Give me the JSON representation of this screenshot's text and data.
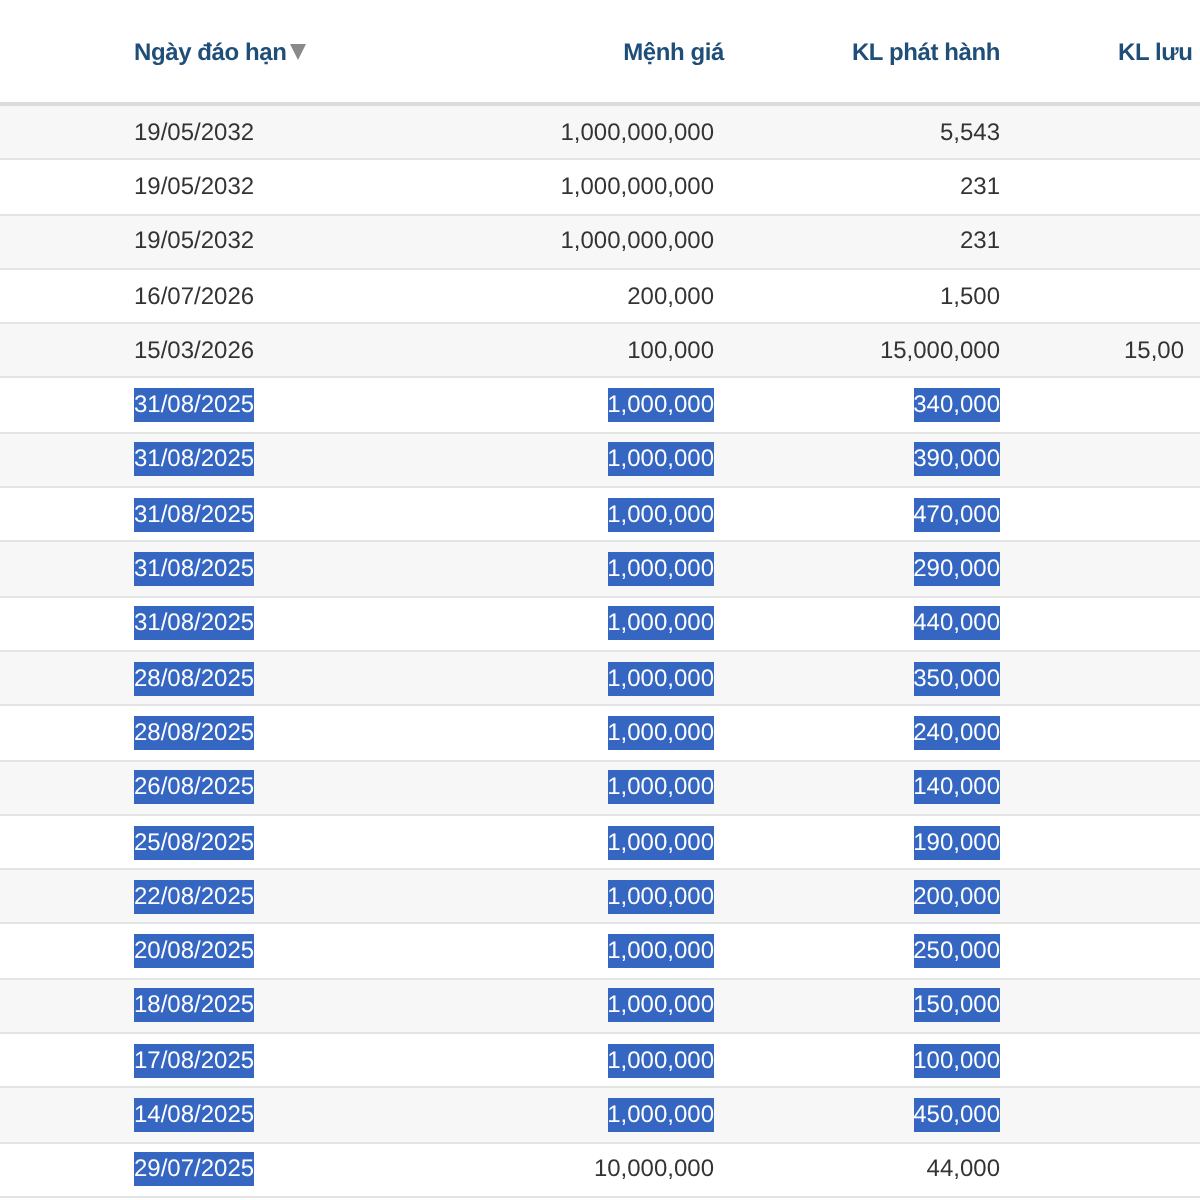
{
  "table": {
    "columns": [
      {
        "label": "Ngày đáo hạn",
        "sorted": true
      },
      {
        "label": "Mệnh giá",
        "sorted": false
      },
      {
        "label": "KL phát hành",
        "sorted": false
      },
      {
        "label": "KL lưu",
        "sorted": false
      }
    ],
    "rows": [
      {
        "cells": [
          {
            "text": "19/05/2032",
            "selected": false
          },
          {
            "text": "1,000,000,000",
            "selected": false
          },
          {
            "text": "5,543",
            "selected": false
          }
        ]
      },
      {
        "cells": [
          {
            "text": "19/05/2032",
            "selected": false
          },
          {
            "text": "1,000,000,000",
            "selected": false
          },
          {
            "text": "231",
            "selected": false
          }
        ]
      },
      {
        "cells": [
          {
            "text": "19/05/2032",
            "selected": false
          },
          {
            "text": "1,000,000,000",
            "selected": false
          },
          {
            "text": "231",
            "selected": false
          }
        ]
      },
      {
        "cells": [
          {
            "text": "16/07/2026",
            "selected": false
          },
          {
            "text": "200,000",
            "selected": false
          },
          {
            "text": "1,500",
            "selected": false
          }
        ]
      },
      {
        "cells": [
          {
            "text": "15/03/2026",
            "selected": false
          },
          {
            "text": "100,000",
            "selected": false
          },
          {
            "text": "15,000,000",
            "selected": false
          },
          {
            "text": "15,00",
            "selected": false
          }
        ]
      },
      {
        "cells": [
          {
            "text": "31/08/2025",
            "selected": true
          },
          {
            "text": "1,000,000",
            "selected": true
          },
          {
            "text": "340,000",
            "selected": true
          }
        ]
      },
      {
        "cells": [
          {
            "text": "31/08/2025",
            "selected": true
          },
          {
            "text": "1,000,000",
            "selected": true
          },
          {
            "text": "390,000",
            "selected": true
          }
        ]
      },
      {
        "cells": [
          {
            "text": "31/08/2025",
            "selected": true
          },
          {
            "text": "1,000,000",
            "selected": true
          },
          {
            "text": "470,000",
            "selected": true
          }
        ]
      },
      {
        "cells": [
          {
            "text": "31/08/2025",
            "selected": true
          },
          {
            "text": "1,000,000",
            "selected": true
          },
          {
            "text": "290,000",
            "selected": true
          }
        ]
      },
      {
        "cells": [
          {
            "text": "31/08/2025",
            "selected": true
          },
          {
            "text": "1,000,000",
            "selected": true
          },
          {
            "text": "440,000",
            "selected": true
          }
        ]
      },
      {
        "cells": [
          {
            "text": "28/08/2025",
            "selected": true
          },
          {
            "text": "1,000,000",
            "selected": true
          },
          {
            "text": "350,000",
            "selected": true
          }
        ]
      },
      {
        "cells": [
          {
            "text": "28/08/2025",
            "selected": true
          },
          {
            "text": "1,000,000",
            "selected": true
          },
          {
            "text": "240,000",
            "selected": true
          }
        ]
      },
      {
        "cells": [
          {
            "text": "26/08/2025",
            "selected": true
          },
          {
            "text": "1,000,000",
            "selected": true
          },
          {
            "text": "140,000",
            "selected": true
          }
        ]
      },
      {
        "cells": [
          {
            "text": "25/08/2025",
            "selected": true
          },
          {
            "text": "1,000,000",
            "selected": true
          },
          {
            "text": "190,000",
            "selected": true
          }
        ]
      },
      {
        "cells": [
          {
            "text": "22/08/2025",
            "selected": true
          },
          {
            "text": "1,000,000",
            "selected": true
          },
          {
            "text": "200,000",
            "selected": true
          }
        ]
      },
      {
        "cells": [
          {
            "text": "20/08/2025",
            "selected": true
          },
          {
            "text": "1,000,000",
            "selected": true
          },
          {
            "text": "250,000",
            "selected": true
          }
        ]
      },
      {
        "cells": [
          {
            "text": "18/08/2025",
            "selected": true
          },
          {
            "text": "1,000,000",
            "selected": true
          },
          {
            "text": "150,000",
            "selected": true
          }
        ]
      },
      {
        "cells": [
          {
            "text": "17/08/2025",
            "selected": true
          },
          {
            "text": "1,000,000",
            "selected": true
          },
          {
            "text": "100,000",
            "selected": true
          }
        ]
      },
      {
        "cells": [
          {
            "text": "14/08/2025",
            "selected": true
          },
          {
            "text": "1,000,000",
            "selected": true
          },
          {
            "text": "450,000",
            "selected": true
          }
        ]
      },
      {
        "cells": [
          {
            "text": "29/07/2025",
            "selected": true
          },
          {
            "text": "10,000,000",
            "selected": false
          },
          {
            "text": "44,000",
            "selected": false
          }
        ]
      }
    ]
  }
}
